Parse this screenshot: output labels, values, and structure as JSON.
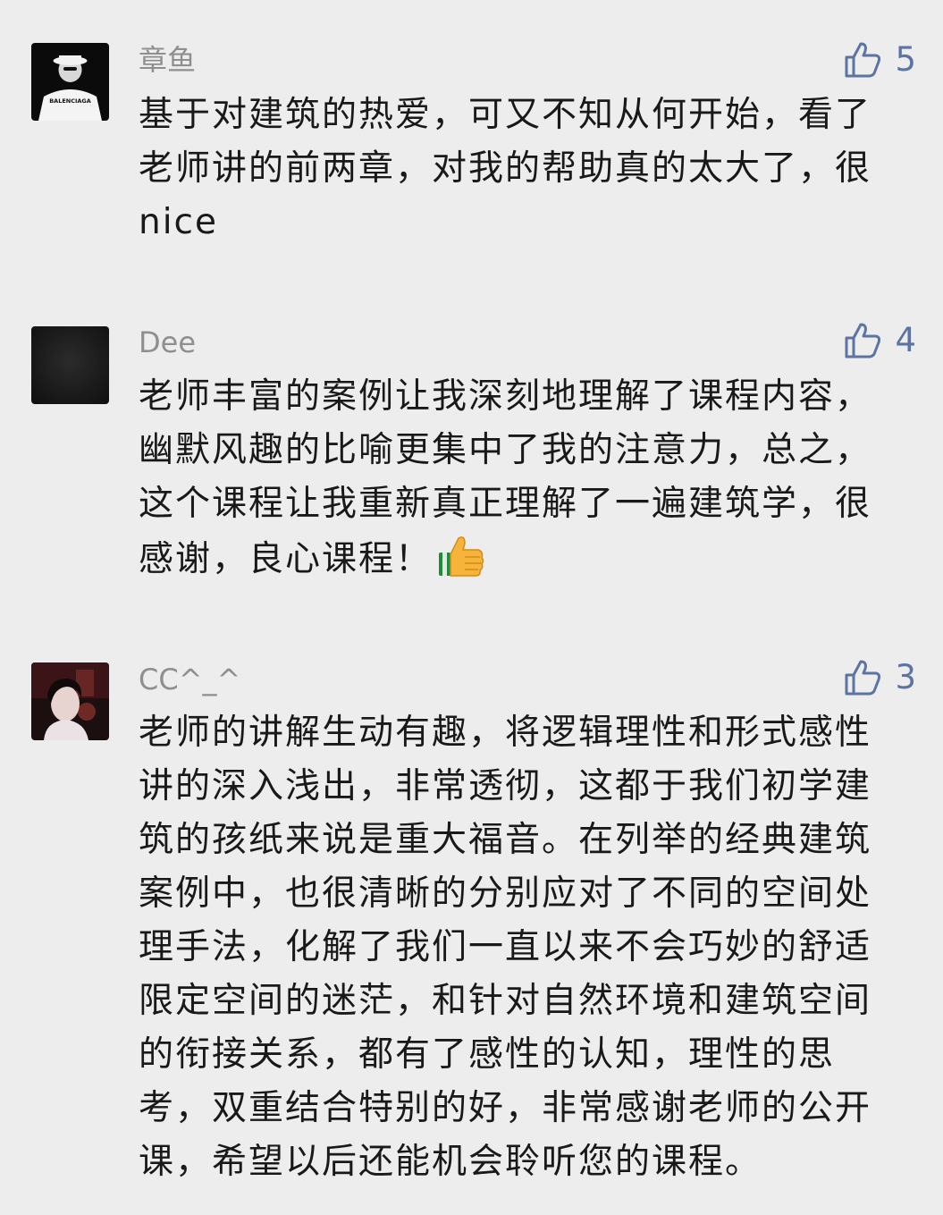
{
  "comments": [
    {
      "username": "章鱼",
      "likes": "5",
      "lines": [
        "基于对建筑的热爱，可又不知从何开始，看了",
        "老师讲的前两章，对我的帮助真的太大了，很",
        "nice"
      ],
      "avatar_text": "BALENCIAGA"
    },
    {
      "username": "Dee",
      "likes": "4",
      "lines": [
        "老师丰富的案例让我深刻地理解了课程内容，",
        "幽默风趣的比喻更集中了我的注意力，总之，",
        "这个课程让我重新真正理解了一遍建筑学，很",
        "感谢，良心课程！"
      ],
      "trailing_emoji": "thumbs-up-emoji"
    },
    {
      "username": "CC^_^",
      "likes": "3",
      "lines": [
        "老师的讲解生动有趣，将逻辑理性和形式感性",
        "讲的深入浅出，非常透彻，这都于我们初学建",
        "筑的孩纸来说是重大福音。在列举的经典建筑",
        "案例中，也很清晰的分别应对了不同的空间处",
        "理手法，化解了我们一直以来不会巧妙的舒适",
        "限定空间的迷茫，和针对自然环境和建筑空间",
        "的衔接关系，都有了感性的认知，理性的思",
        "考，双重结合特别的好，非常感谢老师的公开",
        "课，希望以后还能机会聆听您的课程。"
      ]
    }
  ],
  "icons": {
    "like": "thumbs-up-outline-icon"
  },
  "colors": {
    "background": "#ededed",
    "username": "#8f8f8f",
    "like_accent": "#5c74a1",
    "comment_text": "#191919"
  }
}
